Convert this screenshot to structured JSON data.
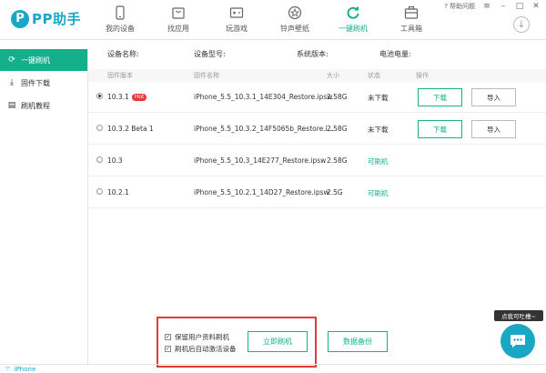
{
  "app": {
    "logo_mark": "P",
    "logo_text": "PP助手"
  },
  "nav": [
    {
      "label": "我的设备",
      "icon": "phone-icon"
    },
    {
      "label": "找应用",
      "icon": "bag-icon"
    },
    {
      "label": "玩游戏",
      "icon": "gamepad-icon"
    },
    {
      "label": "铃声壁纸",
      "icon": "star-icon"
    },
    {
      "label": "一键刷机",
      "icon": "refresh-icon",
      "active": true
    },
    {
      "label": "工具箱",
      "icon": "toolbox-icon"
    }
  ],
  "window": {
    "help_label": "帮助问题"
  },
  "sidebar": [
    {
      "label": "一键刷机",
      "icon": "refresh-icon",
      "active": true
    },
    {
      "label": "固件下载",
      "icon": "download-icon"
    },
    {
      "label": "刷机教程",
      "icon": "document-icon"
    }
  ],
  "device_info": {
    "name_label": "设备名称:",
    "model_label": "设备型号:",
    "version_label": "系统版本:",
    "battery_label": "电池电量:"
  },
  "table": {
    "headers": [
      "固件版本",
      "固件名称",
      "大小",
      "状态",
      "操作"
    ],
    "rows": [
      {
        "version": "10.3.1",
        "hot": "Hot",
        "selected": true,
        "name": "iPhone_5.5_10.3.1_14E304_Restore.ipsw",
        "size": "2.58G",
        "status": "未下载",
        "status_ok": false,
        "download_label": "下载",
        "import_label": "导入"
      },
      {
        "version": "10.3.2 Beta 1",
        "selected": false,
        "name": "iPhone_5.5_10.3.2_14F5065b_Restore.i...",
        "size": "2.58G",
        "status": "未下载",
        "status_ok": false,
        "download_label": "下载",
        "import_label": "导入"
      },
      {
        "version": "10.3",
        "selected": false,
        "name": "iPhone_5.5_10.3_14E277_Restore.ipsw",
        "size": "2.58G",
        "status": "可刷机",
        "status_ok": true
      },
      {
        "version": "10.2.1",
        "selected": false,
        "name": "iPhone_5.5_10.2.1_14D27_Restore.ipsw",
        "size": "2.5G",
        "status": "可刷机",
        "status_ok": true
      }
    ]
  },
  "actions": {
    "keep_data_label": "保留用户资料刷机",
    "auto_activate_label": "刷机后自动激活设备",
    "flash_label": "立即刷机",
    "backup_label": "数据备份"
  },
  "feedback": {
    "tooltip": "点我可吐槽~"
  },
  "statusbar": {
    "device": "iPhone"
  },
  "colors": {
    "accent": "#14b08c",
    "brand": "#1aa7c4",
    "highlight": "#e53935"
  }
}
